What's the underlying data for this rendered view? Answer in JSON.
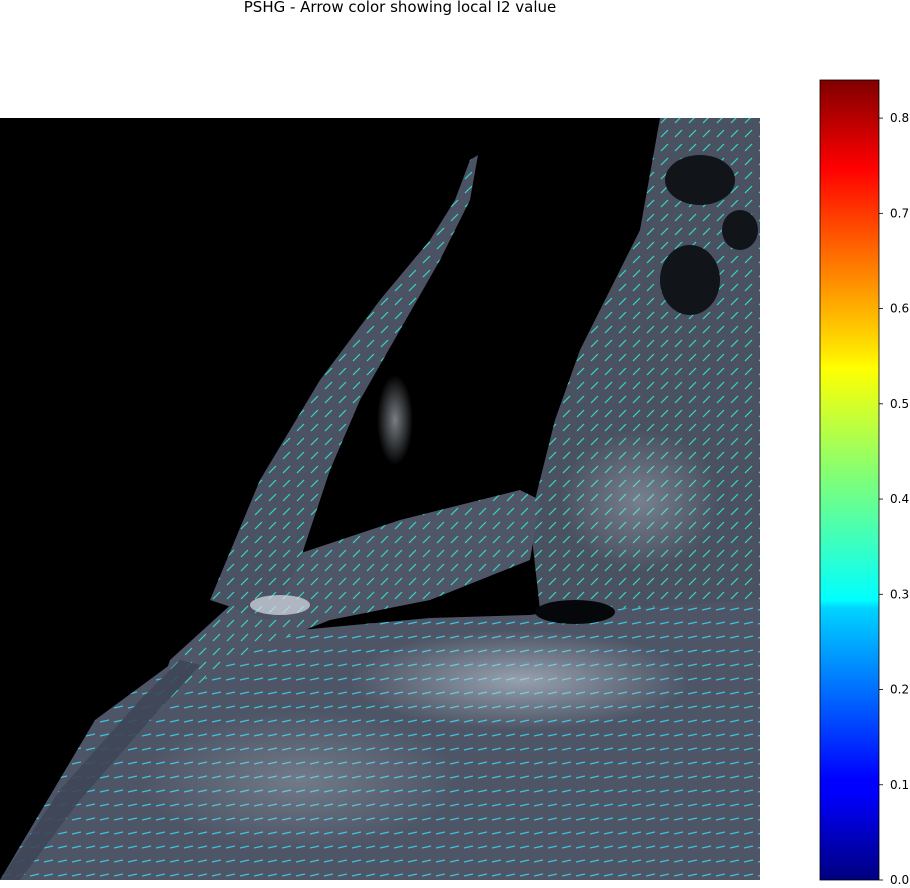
{
  "chart_data": {
    "type": "heatmap",
    "title": "PSHG - Arrow color showing local I2 value",
    "xlabel": "",
    "ylabel": "",
    "colorbar": {
      "colormap": "jet",
      "range": [
        0.0,
        0.84
      ],
      "ticks": [
        0.0,
        0.1,
        0.2,
        0.3,
        0.4,
        0.5,
        0.6,
        0.7,
        0.8
      ],
      "tick_labels": [
        "0.0",
        "0.1",
        "0.2",
        "0.3",
        "0.4",
        "0.5",
        "0.6",
        "0.7",
        "0.8"
      ],
      "placement": "right"
    },
    "background": "grayscale tissue image on black with overlaid orientation arrows",
    "arrow_typical_value": 0.35,
    "axes_visible": false
  },
  "colors": {
    "background": "#000000",
    "tissue": "#5a6272",
    "arrow_main": "#36e0c8"
  }
}
